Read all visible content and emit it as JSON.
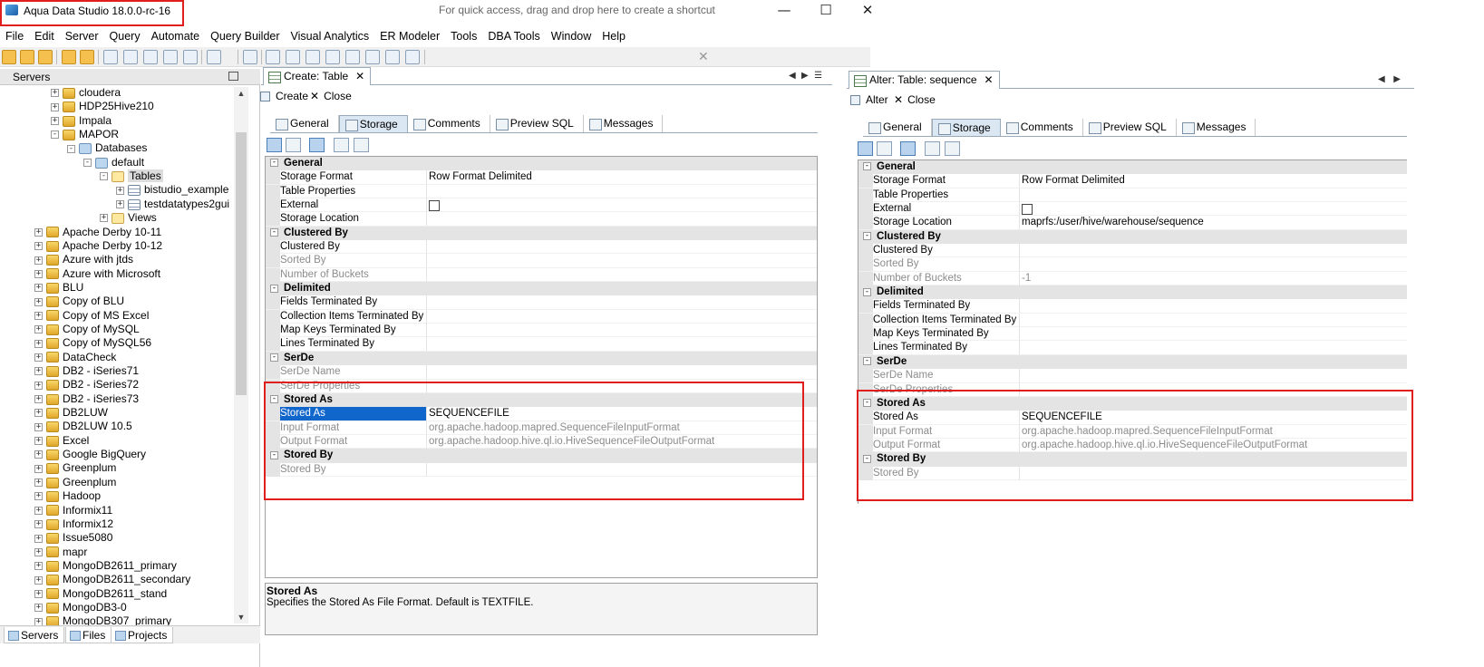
{
  "window": {
    "title": "Aqua Data Studio 18.0.0-rc-16",
    "minimize": "—",
    "maximize": "☐",
    "close": "✕"
  },
  "menu": [
    "File",
    "Edit",
    "Server",
    "Query",
    "Automate",
    "Query Builder",
    "Visual Analytics",
    "ER Modeler",
    "Tools",
    "DBA Tools",
    "Window",
    "Help"
  ],
  "toolbar": {
    "hint": "For quick access, drag and drop here to create a shortcut",
    "hint_close": "✕"
  },
  "left_panel": {
    "title": "Servers",
    "tree": [
      {
        "label": "cloudera",
        "depth": 3,
        "icon": "server-icon",
        "exp": "+"
      },
      {
        "label": "HDP25Hive210",
        "depth": 3,
        "icon": "server-icon",
        "exp": "+"
      },
      {
        "label": "Impala",
        "depth": 3,
        "icon": "server-icon",
        "exp": "+"
      },
      {
        "label": "MAPOR",
        "depth": 3,
        "icon": "server-icon",
        "exp": "−"
      },
      {
        "label": "Databases",
        "depth": 4,
        "icon": "database-icon",
        "exp": "−"
      },
      {
        "label": "default",
        "depth": 5,
        "icon": "database-icon",
        "exp": "−"
      },
      {
        "label": "Tables",
        "depth": 6,
        "icon": "folder-icon",
        "exp": "−",
        "selected": true
      },
      {
        "label": "bistudio_example",
        "depth": 7,
        "icon": "table-icon",
        "exp": "+"
      },
      {
        "label": "testdatatypes2gui",
        "depth": 7,
        "icon": "table-icon",
        "exp": "+"
      },
      {
        "label": "Views",
        "depth": 6,
        "icon": "folder-icon",
        "exp": "+"
      },
      {
        "label": "Apache Derby 10-11",
        "depth": 2,
        "icon": "server-icon",
        "exp": "+"
      },
      {
        "label": "Apache Derby 10-12",
        "depth": 2,
        "icon": "server-icon",
        "exp": "+"
      },
      {
        "label": "Azure with jtds",
        "depth": 2,
        "icon": "server-icon",
        "exp": "+"
      },
      {
        "label": "Azure with Microsoft",
        "depth": 2,
        "icon": "server-icon",
        "exp": "+"
      },
      {
        "label": "BLU",
        "depth": 2,
        "icon": "server-icon",
        "exp": "+"
      },
      {
        "label": "Copy of BLU",
        "depth": 2,
        "icon": "server-icon",
        "exp": "+"
      },
      {
        "label": "Copy of MS Excel",
        "depth": 2,
        "icon": "server-icon",
        "exp": "+"
      },
      {
        "label": "Copy of MySQL",
        "depth": 2,
        "icon": "server-icon",
        "exp": "+"
      },
      {
        "label": "Copy of MySQL56",
        "depth": 2,
        "icon": "server-icon",
        "exp": "+"
      },
      {
        "label": "DataCheck",
        "depth": 2,
        "icon": "server-icon",
        "exp": "+"
      },
      {
        "label": "DB2 - iSeries71",
        "depth": 2,
        "icon": "server-icon",
        "exp": "+"
      },
      {
        "label": "DB2 - iSeries72",
        "depth": 2,
        "icon": "server-icon",
        "exp": "+"
      },
      {
        "label": "DB2 - iSeries73",
        "depth": 2,
        "icon": "server-icon",
        "exp": "+"
      },
      {
        "label": "DB2LUW",
        "depth": 2,
        "icon": "server-icon",
        "exp": "+"
      },
      {
        "label": "DB2LUW 10.5",
        "depth": 2,
        "icon": "server-icon",
        "exp": "+"
      },
      {
        "label": "Excel",
        "depth": 2,
        "icon": "server-icon",
        "exp": "+"
      },
      {
        "label": "Google BigQuery",
        "depth": 2,
        "icon": "server-icon",
        "exp": "+"
      },
      {
        "label": "Greenplum",
        "depth": 2,
        "icon": "server-icon",
        "exp": "+"
      },
      {
        "label": "Greenplum",
        "depth": 2,
        "icon": "server-green-icon",
        "exp": "+"
      },
      {
        "label": "Hadoop",
        "depth": 2,
        "icon": "server-icon",
        "exp": "+"
      },
      {
        "label": "Informix11",
        "depth": 2,
        "icon": "server-icon",
        "exp": "+"
      },
      {
        "label": "Informix12",
        "depth": 2,
        "icon": "server-icon",
        "exp": "+"
      },
      {
        "label": "Issue5080",
        "depth": 2,
        "icon": "server-icon",
        "exp": "+"
      },
      {
        "label": "mapr",
        "depth": 2,
        "icon": "server-icon",
        "exp": "+"
      },
      {
        "label": "MongoDB2611_primary",
        "depth": 2,
        "icon": "server-icon",
        "exp": "+"
      },
      {
        "label": "MongoDB2611_secondary",
        "depth": 2,
        "icon": "server-icon",
        "exp": "+"
      },
      {
        "label": "MongoDB2611_stand",
        "depth": 2,
        "icon": "server-icon",
        "exp": "+"
      },
      {
        "label": "MongoDB3-0",
        "depth": 2,
        "icon": "server-icon",
        "exp": "+"
      },
      {
        "label": "MongoDB307_primary",
        "depth": 2,
        "icon": "server-icon",
        "exp": "+"
      }
    ],
    "bottom_tabs": [
      "Servers",
      "Files",
      "Projects"
    ]
  },
  "create_panel": {
    "tab_label": "Create: Table",
    "tab_close": "✕",
    "action_primary": "Create",
    "action_close": "Close",
    "subtabs": [
      "General",
      "Storage",
      "Comments",
      "Preview SQL",
      "Messages"
    ],
    "active_subtab": 1,
    "sections": [
      {
        "title": "General",
        "rows": [
          {
            "name": "Storage Format",
            "value": "Row Format Delimited"
          },
          {
            "name": "Table Properties",
            "value": ""
          },
          {
            "name": "External",
            "value": "",
            "checkbox": true
          },
          {
            "name": "Storage Location",
            "value": ""
          }
        ]
      },
      {
        "title": "Clustered By",
        "rows": [
          {
            "name": "Clustered By",
            "value": ""
          },
          {
            "name": "Sorted By",
            "value": "",
            "dim": true
          },
          {
            "name": "Number of Buckets",
            "value": "",
            "dim": true
          }
        ]
      },
      {
        "title": "Delimited",
        "rows": [
          {
            "name": "Fields Terminated By",
            "value": ""
          },
          {
            "name": "Collection Items Terminated By",
            "value": ""
          },
          {
            "name": "Map Keys Terminated By",
            "value": ""
          },
          {
            "name": "Lines Terminated By",
            "value": ""
          }
        ]
      },
      {
        "title": "SerDe",
        "rows": [
          {
            "name": "SerDe Name",
            "value": "",
            "dim": true
          },
          {
            "name": "SerDe Properties",
            "value": "",
            "dim": true
          }
        ]
      },
      {
        "title": "Stored As",
        "rows": [
          {
            "name": "Stored As",
            "value": "SEQUENCEFILE",
            "selected": true
          },
          {
            "name": "Input Format",
            "value": "org.apache.hadoop.mapred.SequenceFileInputFormat",
            "dim": true
          },
          {
            "name": "Output Format",
            "value": "org.apache.hadoop.hive.ql.io.HiveSequenceFileOutputFormat",
            "dim": true
          }
        ]
      },
      {
        "title": "Stored By",
        "rows": [
          {
            "name": "Stored By",
            "value": "",
            "dim": true
          }
        ]
      }
    ],
    "description_title": "Stored As",
    "description_body": "Specifies the Stored As File Format. Default is TEXTFILE."
  },
  "alter_panel": {
    "tab_label": "Alter: Table: sequence",
    "tab_close": "✕",
    "action_primary": "Alter",
    "action_close": "Close",
    "subtabs": [
      "General",
      "Storage",
      "Comments",
      "Preview SQL",
      "Messages"
    ],
    "active_subtab": 1,
    "sections": [
      {
        "title": "General",
        "rows": [
          {
            "name": "Storage Format",
            "value": "Row Format Delimited"
          },
          {
            "name": "Table Properties",
            "value": ""
          },
          {
            "name": "External",
            "value": "",
            "checkbox": true
          },
          {
            "name": "Storage Location",
            "value": "maprfs:/user/hive/warehouse/sequence"
          }
        ]
      },
      {
        "title": "Clustered By",
        "rows": [
          {
            "name": "Clustered By",
            "value": ""
          },
          {
            "name": "Sorted By",
            "value": "",
            "dim": true
          },
          {
            "name": "Number of Buckets",
            "value": "-1",
            "dim": true
          }
        ]
      },
      {
        "title": "Delimited",
        "rows": [
          {
            "name": "Fields Terminated By",
            "value": ""
          },
          {
            "name": "Collection Items Terminated By",
            "value": ""
          },
          {
            "name": "Map Keys Terminated By",
            "value": ""
          },
          {
            "name": "Lines Terminated By",
            "value": ""
          }
        ]
      },
      {
        "title": "SerDe",
        "rows": [
          {
            "name": "SerDe Name",
            "value": "",
            "dim": true
          },
          {
            "name": "SerDe Properties",
            "value": "",
            "dim": true
          }
        ]
      },
      {
        "title": "Stored As",
        "rows": [
          {
            "name": "Stored As",
            "value": "SEQUENCEFILE"
          },
          {
            "name": "Input Format",
            "value": "org.apache.hadoop.mapred.SequenceFileInputFormat",
            "dim": true
          },
          {
            "name": "Output Format",
            "value": "org.apache.hadoop.hive.ql.io.HiveSequenceFileOutputFormat",
            "dim": true
          }
        ]
      },
      {
        "title": "Stored By",
        "rows": [
          {
            "name": "Stored By",
            "value": "",
            "dim": true
          }
        ]
      }
    ]
  },
  "colors": {
    "highlight_box": "#e01e1e",
    "selection": "#1166cc",
    "section_bg": "#e4e4e4"
  }
}
